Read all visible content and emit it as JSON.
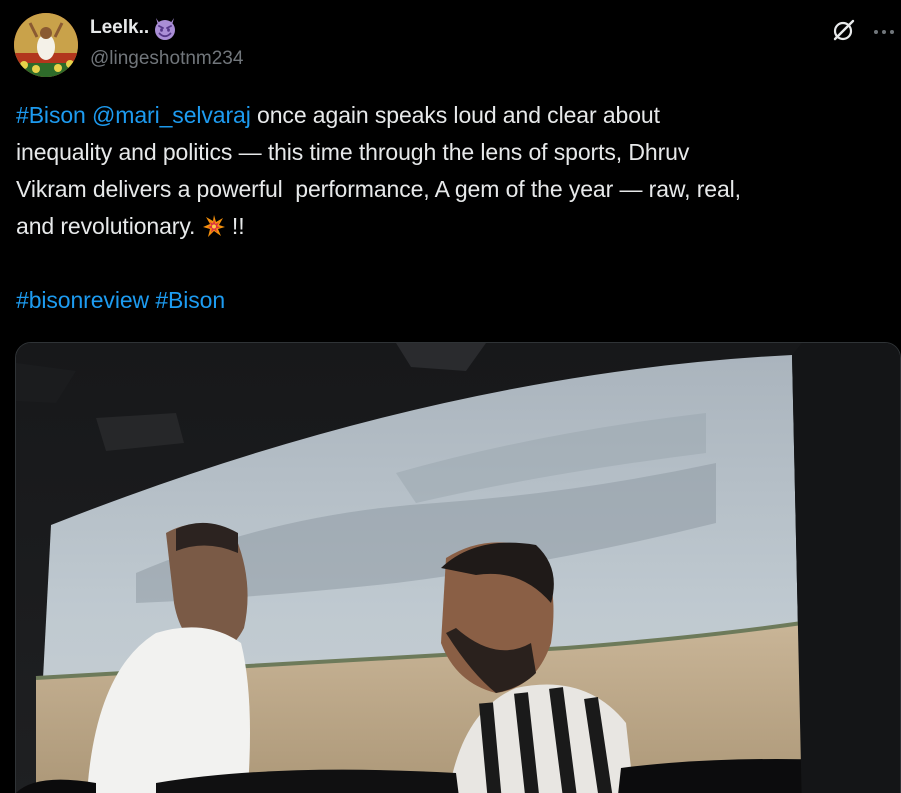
{
  "author": {
    "display_name": "Leelk..",
    "display_name_emoji": "smiling-face-with-horns-emoji",
    "handle": "@lingeshotnm234",
    "avatar": "profile-photo"
  },
  "actions": {
    "grok_icon": "grok-icon",
    "more_icon": "more-icon"
  },
  "tweet": {
    "line1": {
      "hashtag": "#Bison",
      "space": " ",
      "mention": "@mari_selvaraj",
      "text": " once again speaks loud and clear about"
    },
    "line2": "inequality and politics — this time through the lens of sports, Dhruv",
    "line3": "Vikram delivers a powerful  performance, A gem of the year — raw, real,",
    "line4": {
      "text_before": "and revolutionary. ",
      "emoji": "collision-emoji",
      "text_after": " !!"
    },
    "hashtags": [
      "#bisonreview",
      "#Bison"
    ]
  },
  "media": {
    "type": "photo",
    "description_icon": "cinema-screen-photo"
  },
  "colors": {
    "background": "#000000",
    "text": "#e7e9ea",
    "secondary_text": "#71767b",
    "link": "#1d9bf0",
    "border": "#2f3336"
  }
}
